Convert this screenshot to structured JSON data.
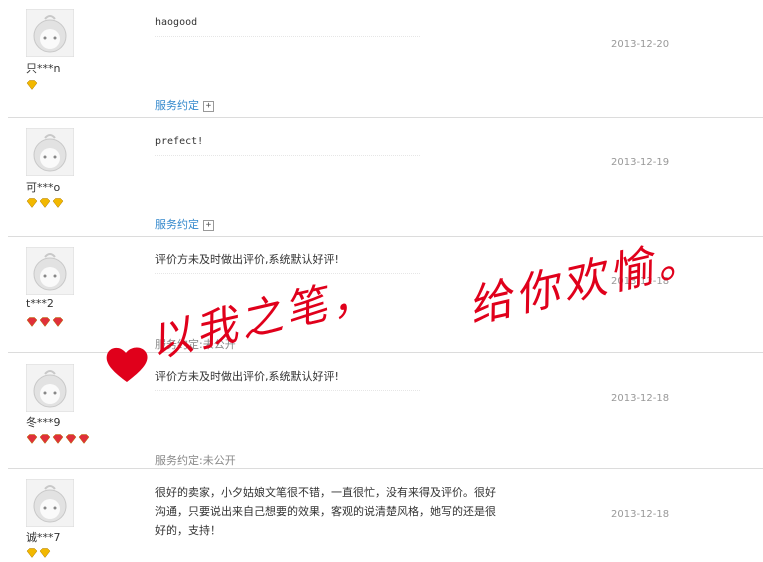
{
  "reviews": [
    {
      "username": "只***n",
      "comment": "haogood",
      "date": "2013-12-20",
      "service_label": "服务约定",
      "service_value": "",
      "expand_symbol": "+",
      "badge_count": 1,
      "badge_color": "#f2b800"
    },
    {
      "username": "可***o",
      "comment": "prefect!",
      "date": "2013-12-19",
      "service_label": "服务约定",
      "service_value": "",
      "expand_symbol": "+",
      "badge_count": 3,
      "badge_color": "#f2b800"
    },
    {
      "username": "t***2",
      "comment": "评价方未及时做出评价,系统默认好评!",
      "date": "2013-12-18",
      "service_label": "服务约定",
      "service_value": ":未公开",
      "badge_count": 3,
      "badge_color": "#e0303a"
    },
    {
      "username": "冬***9",
      "comment": "评价方未及时做出评价,系统默认好评!",
      "date": "2013-12-18",
      "service_label": "服务约定",
      "service_value": ":未公开",
      "badge_count": 5,
      "badge_color": "#e0303a"
    },
    {
      "username": "诚***7",
      "comment": "很好的卖家，小夕姑娘文笔很不错，一直很忙，没有来得及评价。很好沟通，只要说出来自己想要的效果，客观的说清楚风格，她写的还是很好的，支持！",
      "date": "2013-12-18",
      "badge_count": 2,
      "badge_color": "#f2b800"
    }
  ],
  "overlay": {
    "text_one": "以我之笔，",
    "text_two": "给你欢愉。",
    "color": "#e0001b",
    "heart_icon": "heart-icon"
  }
}
